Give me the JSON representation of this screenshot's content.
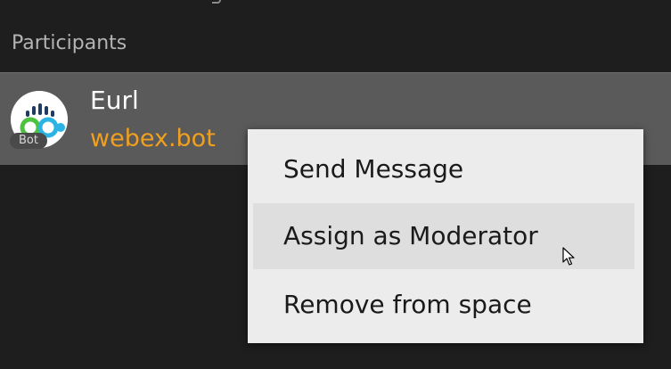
{
  "section": {
    "title": "Participants"
  },
  "participant": {
    "name": "Eurl",
    "email": "webex.bot",
    "badge": "Bot",
    "avatar_icon": "webex-bot-logo-icon"
  },
  "context_menu": {
    "items": [
      {
        "label": "Send Message",
        "hovered": false
      },
      {
        "label": "Assign as Moderator",
        "hovered": true
      },
      {
        "label": "Remove from space",
        "hovered": false
      }
    ]
  },
  "colors": {
    "background": "#1e1e1e",
    "row_selected": "#5a5a5a",
    "email_accent": "#f0a01e",
    "menu_background": "#ececec",
    "menu_hover": "#dedede"
  }
}
